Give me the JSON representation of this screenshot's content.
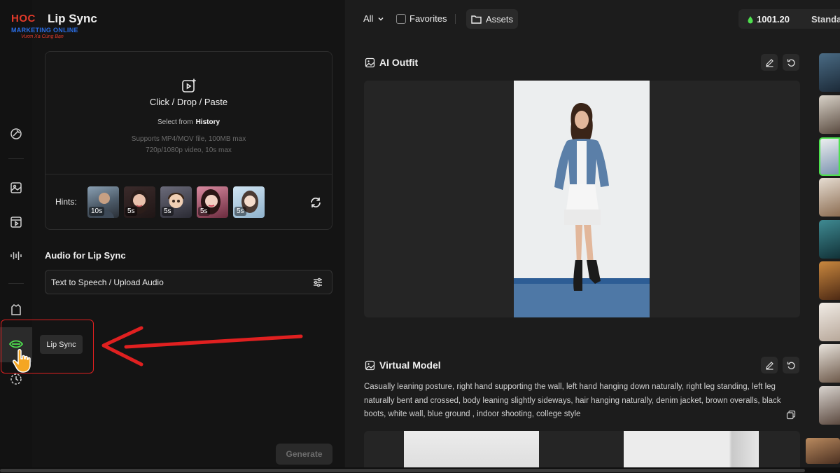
{
  "brand": {
    "logo_text": "HOC",
    "title": "Lip Sync",
    "subtitle": "MARKETING ONLINE",
    "tagline": "Vươn Xa Cùng Bạn"
  },
  "sidebar": {
    "items": [
      {
        "name": "magic-edit-icon"
      },
      {
        "name": "image-icon"
      },
      {
        "name": "video-icon"
      },
      {
        "name": "audio-wave-icon"
      },
      {
        "name": "outfit-icon"
      },
      {
        "name": "lips-icon",
        "active": true
      },
      {
        "name": "history-icon"
      }
    ],
    "tooltip": "Lip Sync"
  },
  "upload": {
    "title": "Click / Drop / Paste",
    "select_from": "Select from",
    "history_link": "History",
    "note_line1": "Supports MP4/MOV file, 100MB max",
    "note_line2": "720p/1080p video, 10s max",
    "hints_label": "Hints:",
    "hints": [
      {
        "duration": "10s"
      },
      {
        "duration": "5s"
      },
      {
        "duration": "5s"
      },
      {
        "duration": "5s"
      },
      {
        "duration": "5s"
      }
    ]
  },
  "audio": {
    "label": "Audio for Lip Sync",
    "field_value": "Text to Speech / Upload Audio"
  },
  "generate_label": "Generate",
  "topbar": {
    "filter_label": "All",
    "favorites_label": "Favorites",
    "assets_label": "Assets",
    "credits": "1001.20",
    "plan": "Standa"
  },
  "sections": {
    "outfit_title": "AI Outfit",
    "virtual_model_title": "Virtual Model",
    "virtual_model_desc": "Casually leaning posture, right hand supporting the wall, left hand hanging down naturally, right leg standing, left leg naturally bent and crossed, body leaning slightly sideways, hair hanging naturally, denim jacket, brown overalls, black boots, white wall, blue ground , indoor shooting, college style"
  },
  "colors": {
    "accent_green": "#4ee04e",
    "annotation_red": "#e02020",
    "background": "#161616"
  }
}
